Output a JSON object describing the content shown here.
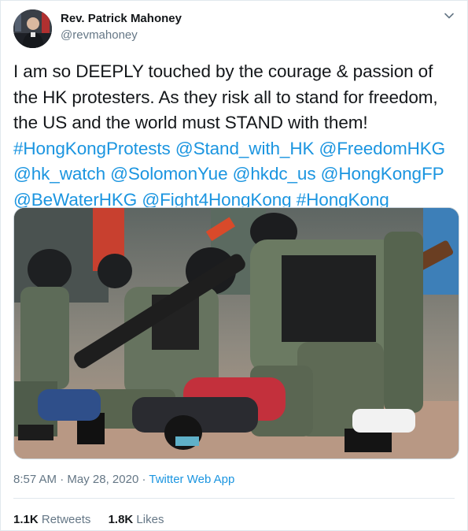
{
  "author": {
    "display_name": "Rev. Patrick Mahoney",
    "handle": "@revmahoney"
  },
  "tweet": {
    "text_plain": "I am so DEEPLY touched by the courage & passion of the HK protesters. As they risk all to stand for freedom, the US and the world must STAND with them!",
    "links": [
      "#HongKongProtests",
      "@Stand_with_HK",
      "@FreedomHKG",
      "@hk_watch",
      "@SolomonYue",
      "@hkdc_us",
      "@HongKongFP",
      "@BeWaterHKG",
      "@Fight4HongKong",
      "#HongKong"
    ]
  },
  "meta": {
    "time": "8:57 AM",
    "separator": "·",
    "date": "May 28, 2020",
    "source": "Twitter Web App"
  },
  "stats": {
    "retweets_count": "1.1K",
    "retweets_label": "Retweets",
    "likes_count": "1.8K",
    "likes_label": "Likes"
  },
  "icons": {
    "caret": "chevron-down-icon"
  },
  "colors": {
    "link": "#1b95e0",
    "secondary_text": "#657786",
    "primary_text": "#14171a"
  }
}
